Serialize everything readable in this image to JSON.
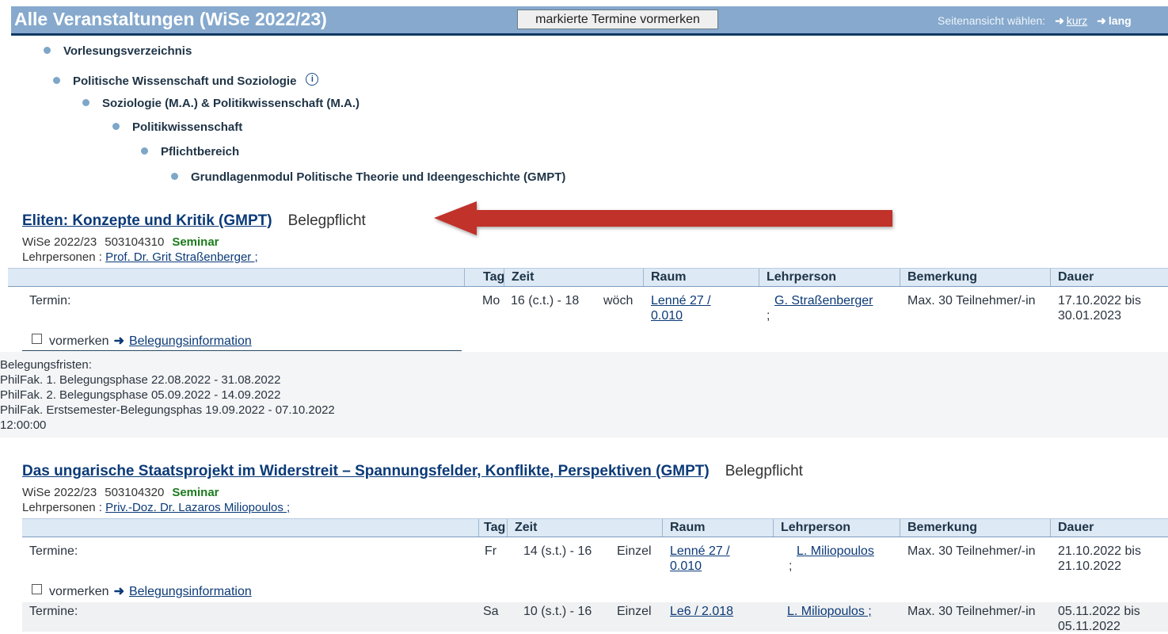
{
  "header": {
    "title": "Alle Veranstaltungen (WiSe 2022/23)",
    "mark_button": "markierte Termine vormerken",
    "view_label": "Seitenansicht wählen:",
    "view_short": "kurz",
    "view_long": "lang"
  },
  "breadcrumb": [
    {
      "label": "Vorlesungsverzeichnis"
    },
    {
      "label": "Politische Wissenschaft und Soziologie"
    },
    {
      "label": "Soziologie (M.A.) & Politikwissenschaft (M.A.)"
    },
    {
      "label": "Politikwissenschaft"
    },
    {
      "label": "Pflichtbereich"
    },
    {
      "label": "Grundlagenmodul Politische Theorie und Ideengeschichte (GMPT)"
    }
  ],
  "table_headers": {
    "tag": "Tag",
    "zeit": "Zeit",
    "raum": "Raum",
    "lehrperson": "Lehrperson",
    "bemerkung": "Bemerkung",
    "dauer": "Dauer"
  },
  "courses": [
    {
      "title": "Eliten: Konzepte und Kritik (GMPT)",
      "flag": "Belegpflicht",
      "semester": "WiSe 2022/23",
      "number": "503104310",
      "type": "Seminar",
      "teachers_label": "Lehrpersonen :",
      "teachers": "Prof. Dr. Grit Straßenberger ;",
      "rows": [
        {
          "label": "Termin:",
          "tag": "Mo",
          "zeit": "16 (c.t.) - 18",
          "rhythmus": "wöch",
          "raum": "Lenné 27 / 0.010",
          "lehrperson": "G. Straßenberger",
          "lp_sep": ";",
          "bemerkung": "Max. 30 Teilnehmer/-in",
          "dauer": "17.10.2022 bis 30.01.2023"
        }
      ],
      "vormerken": "vormerken",
      "belegungsinfo": "Belegungsinformation",
      "fristen": [
        "Belegungsfristen:",
        "PhilFak. 1. Belegungsphase 22.08.2022 - 31.08.2022",
        "PhilFak. 2. Belegungsphase 05.09.2022 - 14.09.2022",
        "PhilFak. Erstsemester-Belegungsphas 19.09.2022 - 07.10.2022",
        "12:00:00"
      ]
    },
    {
      "title": "Das ungarische Staatsprojekt im Widerstreit – Spannungsfelder, Konflikte, Perspektiven (GMPT)",
      "flag": "Belegpflicht",
      "semester": "WiSe 2022/23",
      "number": "503104320",
      "type": "Seminar",
      "teachers_label": "Lehrpersonen :",
      "teachers": "Priv.-Doz. Dr. Lazaros Miliopoulos ;",
      "rows": [
        {
          "label": "Termine:",
          "tag": "Fr",
          "zeit": "14 (s.t.) - 16",
          "rhythmus": "Einzel",
          "raum": "Lenné 27 / 0.010",
          "lehrperson": "L. Miliopoulos",
          "lp_sep": ";",
          "bemerkung": "Max. 30 Teilnehmer/-in",
          "dauer": "21.10.2022 bis 21.10.2022"
        },
        {
          "label": "Termine:",
          "tag": "Sa",
          "zeit": "10 (s.t.) - 16",
          "rhythmus": "Einzel",
          "raum": "Le6 / 2.018",
          "lehrperson": "L. Miliopoulos ;",
          "bemerkung": "Max. 30 Teilnehmer/-in",
          "dauer": "05.11.2022 bis 05.11.2022"
        }
      ],
      "vormerken": "vormerken",
      "belegungsinfo": "Belegungsinformation"
    }
  ],
  "colors": {
    "header_bg": "#86a9cd",
    "header_border": "#0e3a63",
    "link": "#0b3a78",
    "seminar": "#1c7a1c",
    "annotation_arrow": "#c0322b"
  },
  "icons": [
    "bullet-icon",
    "info-icon",
    "arrow-right-icon",
    "checkbox-icon",
    "red-annotation-arrow"
  ]
}
